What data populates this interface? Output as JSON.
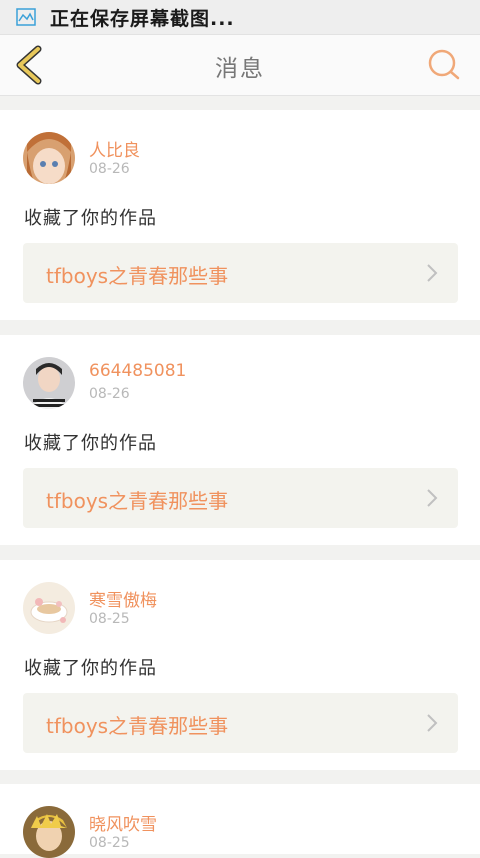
{
  "status_bar": {
    "text": "正在保存屏幕截图..."
  },
  "nav": {
    "title": "消息"
  },
  "colors": {
    "accent": "#f0925e",
    "back_icon": "#e8c85a",
    "card_bg": "#ffffff",
    "page_bg": "#f2f2f0"
  },
  "messages": [
    {
      "username": "人比良",
      "date": "08-26",
      "action": "收藏了你的作品",
      "work_title": "tfboys之青春那些事"
    },
    {
      "username": "664485081",
      "date": "08-26",
      "action": "收藏了你的作品",
      "work_title": "tfboys之青春那些事"
    },
    {
      "username": "寒雪傲梅",
      "date": "08-25",
      "action": "收藏了你的作品",
      "work_title": "tfboys之青春那些事"
    },
    {
      "username": "晓风吹雪",
      "date": "08-25"
    }
  ]
}
